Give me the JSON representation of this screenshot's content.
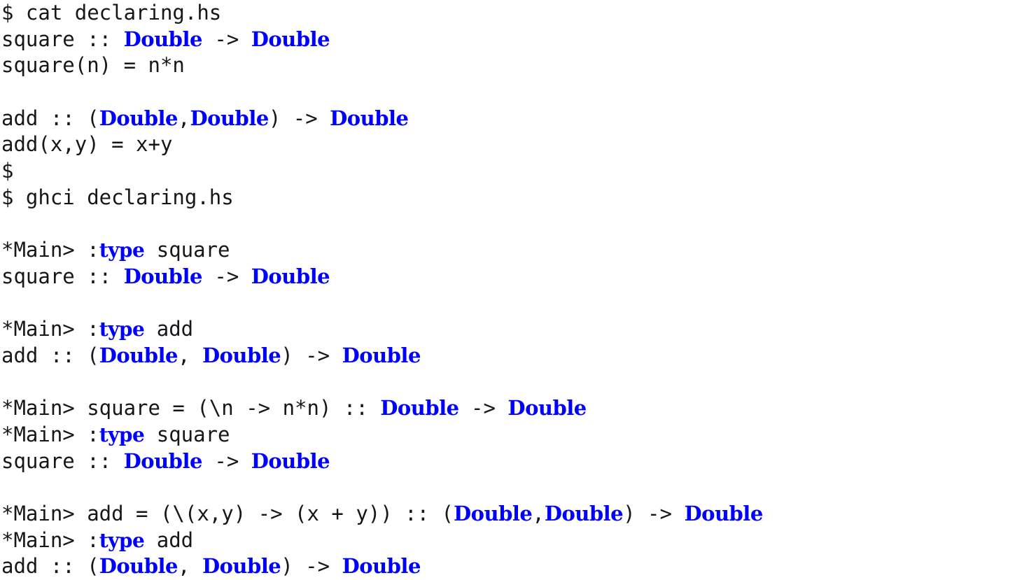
{
  "colors": {
    "background": "#ffffff",
    "text": "#16171a",
    "type_blue": "#0000ff"
  },
  "terminal": {
    "shell_prompt": "$",
    "ghci_prompt": "*Main>",
    "file_name": "declaring.hs",
    "commands": {
      "cat": "cat declaring.hs",
      "ghci": "ghci declaring.hs",
      "type_square": ":type square",
      "type_add": ":type add"
    },
    "lines": [
      {
        "id": "line-cat-command",
        "name": "shell-command-cat",
        "segments": [
          {
            "t": "plain",
            "s": "$ cat declaring.hs"
          }
        ]
      },
      {
        "id": "line-square-signature-file",
        "name": "file-square-type-signature",
        "segments": [
          {
            "t": "plain",
            "s": "square :: "
          },
          {
            "t": "type",
            "s": "Double"
          },
          {
            "t": "plain",
            "s": " -> "
          },
          {
            "t": "type",
            "s": "Double"
          }
        ]
      },
      {
        "id": "line-square-definition-file",
        "name": "file-square-definition",
        "segments": [
          {
            "t": "plain",
            "s": "square(n) = n*n"
          }
        ]
      },
      {
        "id": "line-blank-1",
        "name": "blank-line",
        "segments": []
      },
      {
        "id": "line-add-signature-file",
        "name": "file-add-type-signature",
        "segments": [
          {
            "t": "plain",
            "s": "add :: ("
          },
          {
            "t": "type",
            "s": "Double"
          },
          {
            "t": "plain",
            "s": ","
          },
          {
            "t": "type",
            "s": "Double"
          },
          {
            "t": "plain",
            "s": ") -> "
          },
          {
            "t": "type",
            "s": "Double"
          }
        ]
      },
      {
        "id": "line-add-definition-file",
        "name": "file-add-definition",
        "segments": [
          {
            "t": "plain",
            "s": "add(x,y) = x+y"
          }
        ]
      },
      {
        "id": "line-bare-prompt",
        "name": "shell-prompt-empty",
        "segments": [
          {
            "t": "plain",
            "s": "$"
          }
        ]
      },
      {
        "id": "line-ghci-command",
        "name": "shell-command-ghci",
        "segments": [
          {
            "t": "plain",
            "s": "$ ghci declaring.hs"
          }
        ]
      },
      {
        "id": "line-blank-2",
        "name": "blank-line",
        "segments": []
      },
      {
        "id": "line-ghci-type-square-1",
        "name": "ghci-command-type-square",
        "segments": [
          {
            "t": "plain",
            "s": "*Main> :"
          },
          {
            "t": "kw",
            "s": "type"
          },
          {
            "t": "plain",
            "s": " square"
          }
        ]
      },
      {
        "id": "line-ghci-square-signature-1",
        "name": "ghci-output-square-type",
        "segments": [
          {
            "t": "plain",
            "s": "square :: "
          },
          {
            "t": "type",
            "s": "Double"
          },
          {
            "t": "plain",
            "s": " -> "
          },
          {
            "t": "type",
            "s": "Double"
          }
        ]
      },
      {
        "id": "line-blank-3",
        "name": "blank-line",
        "segments": []
      },
      {
        "id": "line-ghci-type-add-1",
        "name": "ghci-command-type-add",
        "segments": [
          {
            "t": "plain",
            "s": "*Main> :"
          },
          {
            "t": "kw",
            "s": "type"
          },
          {
            "t": "plain",
            "s": " add"
          }
        ]
      },
      {
        "id": "line-ghci-add-signature-1",
        "name": "ghci-output-add-type",
        "segments": [
          {
            "t": "plain",
            "s": "add :: ("
          },
          {
            "t": "type",
            "s": "Double"
          },
          {
            "t": "plain",
            "s": ", "
          },
          {
            "t": "type",
            "s": "Double"
          },
          {
            "t": "plain",
            "s": ") -> "
          },
          {
            "t": "type",
            "s": "Double"
          }
        ]
      },
      {
        "id": "line-blank-4",
        "name": "blank-line",
        "segments": []
      },
      {
        "id": "line-ghci-square-lambda",
        "name": "ghci-command-square-lambda-binding",
        "segments": [
          {
            "t": "plain",
            "s": "*Main> square = (\\n -> n*n) :: "
          },
          {
            "t": "type",
            "s": "Double"
          },
          {
            "t": "plain",
            "s": " -> "
          },
          {
            "t": "type",
            "s": "Double"
          }
        ]
      },
      {
        "id": "line-ghci-type-square-2",
        "name": "ghci-command-type-square",
        "segments": [
          {
            "t": "plain",
            "s": "*Main> :"
          },
          {
            "t": "kw",
            "s": "type"
          },
          {
            "t": "plain",
            "s": " square"
          }
        ]
      },
      {
        "id": "line-ghci-square-signature-2",
        "name": "ghci-output-square-type",
        "segments": [
          {
            "t": "plain",
            "s": "square :: "
          },
          {
            "t": "type",
            "s": "Double"
          },
          {
            "t": "plain",
            "s": " -> "
          },
          {
            "t": "type",
            "s": "Double"
          }
        ]
      },
      {
        "id": "line-blank-5",
        "name": "blank-line",
        "segments": []
      },
      {
        "id": "line-ghci-add-lambda",
        "name": "ghci-command-add-lambda-binding",
        "segments": [
          {
            "t": "plain",
            "s": "*Main> add = (\\(x,y) -> (x + y)) :: ("
          },
          {
            "t": "type",
            "s": "Double"
          },
          {
            "t": "plain",
            "s": ","
          },
          {
            "t": "type",
            "s": "Double"
          },
          {
            "t": "plain",
            "s": ") -> "
          },
          {
            "t": "type",
            "s": "Double"
          }
        ]
      },
      {
        "id": "line-ghci-type-add-2",
        "name": "ghci-command-type-add",
        "segments": [
          {
            "t": "plain",
            "s": "*Main> :"
          },
          {
            "t": "kw",
            "s": "type"
          },
          {
            "t": "plain",
            "s": " add"
          }
        ]
      },
      {
        "id": "line-ghci-add-signature-2",
        "name": "ghci-output-add-type",
        "segments": [
          {
            "t": "plain",
            "s": "add :: ("
          },
          {
            "t": "type",
            "s": "Double"
          },
          {
            "t": "plain",
            "s": ", "
          },
          {
            "t": "type",
            "s": "Double"
          },
          {
            "t": "plain",
            "s": ") -> "
          },
          {
            "t": "type",
            "s": "Double"
          }
        ]
      }
    ]
  }
}
